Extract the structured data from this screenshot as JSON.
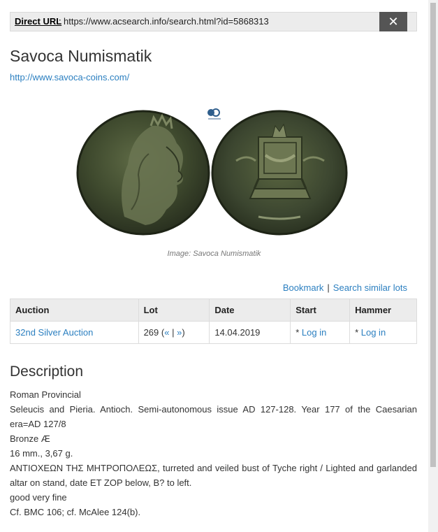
{
  "url_bar": {
    "label": "Direct URL",
    "colon": ":",
    "value": "https://www.acsearch.info/search.html?id=5868313",
    "close_symbol": "✕"
  },
  "dealer": {
    "name": "Savoca Numismatik",
    "website": "http://www.savoca-coins.com/"
  },
  "image": {
    "caption": "Image: Savoca Numismatik",
    "watermark": "acsearch"
  },
  "actions": {
    "bookmark": "Bookmark",
    "separator": "|",
    "similar": "Search similar lots"
  },
  "table": {
    "headers": [
      "Auction",
      "Lot",
      "Date",
      "Start",
      "Hammer"
    ],
    "row": {
      "auction": "32nd Silver Auction",
      "lot": "269",
      "lot_open": "(",
      "lot_prev": "«",
      "lot_sep": "|",
      "lot_next": "»",
      "lot_close": ")",
      "date": "14.04.2019",
      "start_prefix": "* ",
      "start_link": "Log in",
      "hammer_prefix": "* ",
      "hammer_link": "Log in"
    }
  },
  "description": {
    "heading": "Description",
    "lines": [
      "Roman Provincial",
      "Seleucis and Pieria. Antioch. Semi-autonomous issue AD 127-128. Year 177 of the Caesarian era=AD 127/8",
      "Bronze Æ",
      "16 mm., 3,67 g.",
      "ΑΝΤΙΟΧΕΩΝ ΤΗΣ ΜΗΤΡΟΠΟΛΕΩΣ, turreted and veiled bust of Tyche right / Lighted and garlanded altar on stand, date ET ZOP below, B? to left.",
      "good very fine",
      "Cf. BMC 106; cf. McAlee 124(b)."
    ]
  },
  "colors": {
    "link": "#2b7fc0",
    "close_button": "#555555",
    "table_header": "#ececec"
  }
}
